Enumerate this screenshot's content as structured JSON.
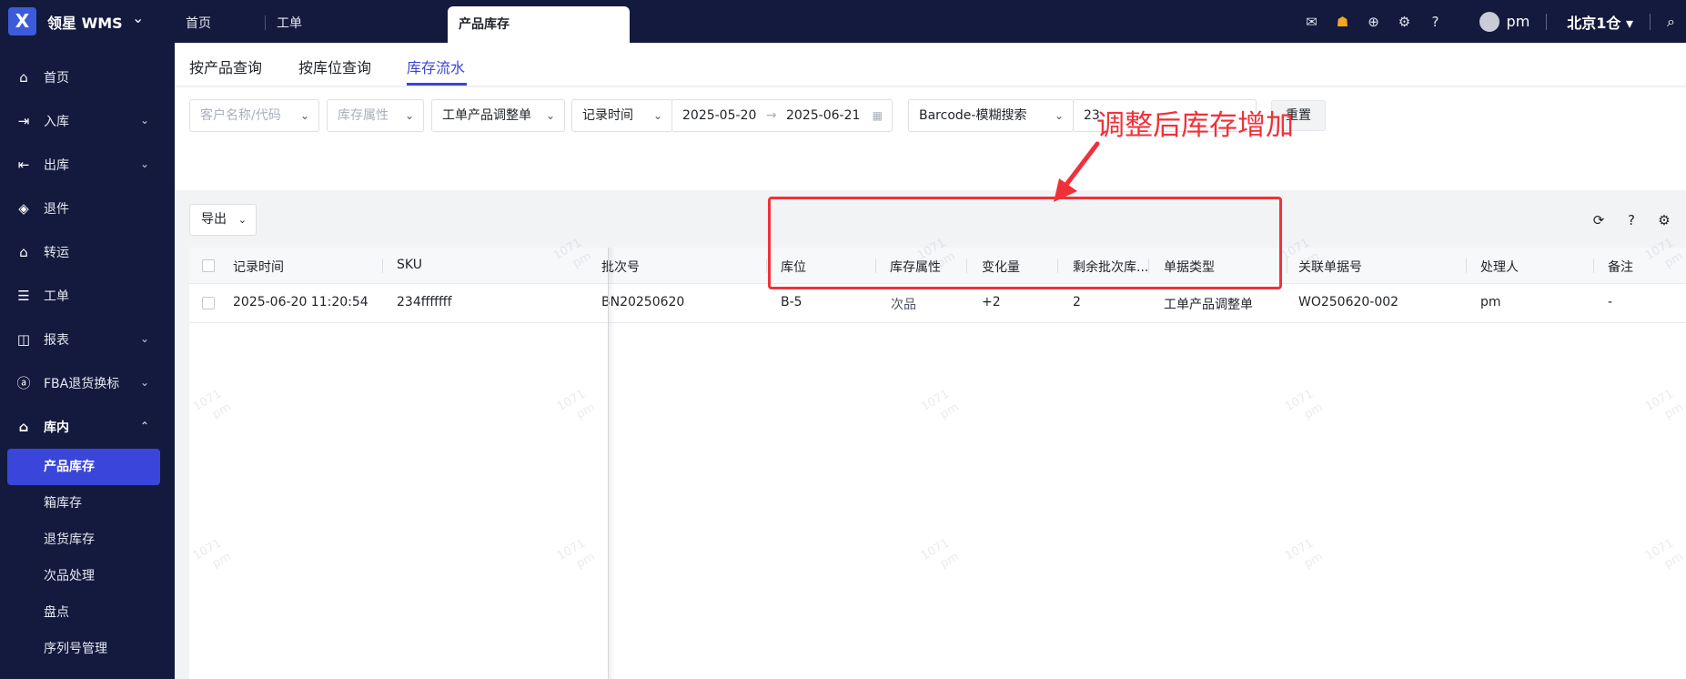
{
  "app": {
    "brand": "领星 WMS",
    "logo": "X"
  },
  "topnav": {
    "tabs": [
      "首页",
      "工单",
      "产品库存"
    ]
  },
  "topbar": {
    "user": "pm",
    "warehouse": "北京1仓"
  },
  "sidebar": {
    "items": [
      {
        "label": "首页",
        "icon": "home-icon"
      },
      {
        "label": "入库",
        "icon": "inbound-icon"
      },
      {
        "label": "出库",
        "icon": "outbound-icon"
      },
      {
        "label": "退件",
        "icon": "return-icon"
      },
      {
        "label": "转运",
        "icon": "transfer-icon"
      },
      {
        "label": "工单",
        "icon": "workorder-icon"
      },
      {
        "label": "报表",
        "icon": "report-icon"
      },
      {
        "label": "FBA退货换标",
        "icon": "fba-icon"
      },
      {
        "label": "库内",
        "icon": "warehouse-icon"
      }
    ],
    "sub_items": [
      "产品库存",
      "箱库存",
      "退货库存",
      "次品处理",
      "盘点",
      "序列号管理"
    ]
  },
  "subtabs": [
    "按产品查询",
    "按库位查询",
    "库存流水"
  ],
  "filters": {
    "customer_placeholder": "客户名称/代码",
    "attr_placeholder": "库存属性",
    "order_type": "工单产品调整单",
    "time_type": "记录时间",
    "date_start": "2025-05-20",
    "date_end": "2025-06-21",
    "search_type": "Barcode-模糊搜索",
    "search_value": "23",
    "reset": "重置"
  },
  "toolbar": {
    "export": "导出"
  },
  "table": {
    "headers": [
      "记录时间",
      "SKU",
      "批次号",
      "库位",
      "库存属性",
      "变化量",
      "剩余批次库...",
      "单据类型",
      "关联单据号",
      "处理人",
      "备注"
    ],
    "rows": [
      [
        "2025-06-20 11:20:54",
        "234fffffff",
        "BN20250620",
        "B-5",
        "次品",
        "+2",
        "2",
        "工单产品调整单",
        "WO250620-002",
        "pm",
        "-"
      ]
    ]
  },
  "watermark": {
    "line1": "1071",
    "line2": "pm"
  },
  "annotation": {
    "text": "调整后库存增加"
  },
  "colors": {
    "nav_bg": "#141a3d",
    "accent": "#3a46d9",
    "highlight": "#f0313a"
  }
}
